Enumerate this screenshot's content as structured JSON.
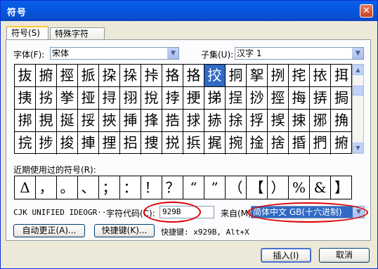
{
  "window": {
    "title": "符号",
    "close_glyph": "✕"
  },
  "tabs": [
    {
      "label": "符号(S)",
      "active": true
    },
    {
      "label": "特殊字符(P)",
      "active": false
    }
  ],
  "font": {
    "label": "字体(F):",
    "value": "宋体"
  },
  "subset": {
    "label": "子集(U):",
    "value": "汉字 1"
  },
  "symbol_grid": {
    "rows": [
      [
        "抜",
        "捬",
        "挳",
        "挀",
        "挅",
        "挆",
        "挊",
        "挌",
        "挌",
        "挍",
        "挏",
        "挐",
        "挒",
        "挓",
        "挔",
        "挕"
      ],
      [
        "挗",
        "挘",
        "挙",
        "挜",
        "挦",
        "挧",
        "挩",
        "挬",
        "挭",
        "挮",
        "挰",
        "挱",
        "挳",
        "挴",
        "挵",
        "挶"
      ],
      [
        "挷",
        "挸",
        "挻",
        "挼",
        "挾",
        "挿",
        "捀",
        "捁",
        "捄",
        "捇",
        "捈",
        "捊",
        "捑",
        "捒",
        "捓",
        "捔"
      ],
      [
        "捖",
        "捗",
        "捘",
        "捙",
        "捚",
        "捛",
        "捜",
        "捝",
        "捠",
        "捤",
        "捥",
        "捦",
        "捨",
        "捪",
        "捫",
        "捬"
      ]
    ],
    "selected": {
      "row": 0,
      "col": 9
    }
  },
  "recent": {
    "label": "近期使用过的符号(R):",
    "symbols": [
      "Δ",
      "，",
      "。",
      "、",
      "；",
      "：",
      "！",
      "？",
      "“",
      "”",
      "（",
      "【",
      "）",
      "%",
      "&",
      "】"
    ]
  },
  "char_name": "CJK UNIFIED IDEOGR···",
  "char_code": {
    "label": "字符代码(C):",
    "value": "929B"
  },
  "from": {
    "label": "来自(M)",
    "value": "简体中文 GB(十六进制)"
  },
  "autocorrect_button": "自动更正(A)...",
  "shortcut_button": "快捷键(K)...",
  "shortcut_text": "快捷键: x929B, Alt+X",
  "insert_button": "插入(I)",
  "cancel_button": "取消"
}
